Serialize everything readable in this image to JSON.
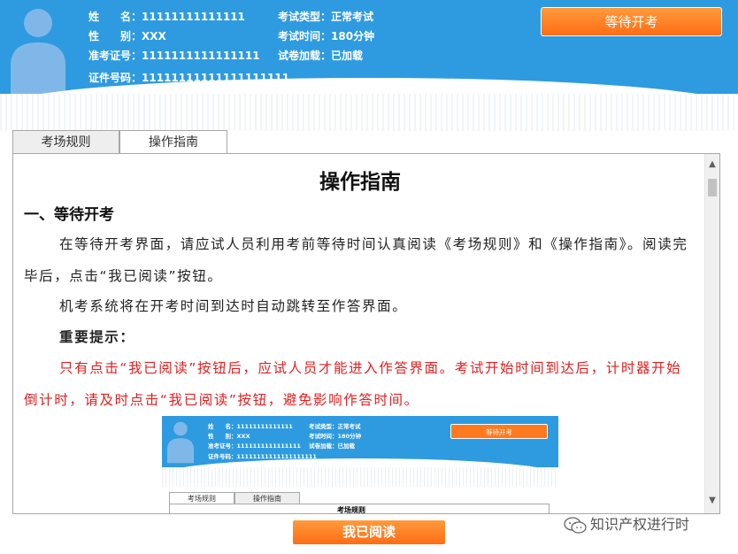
{
  "header": {
    "candidate": {
      "name_label": "姓　　名：",
      "name_value": "11111111111111",
      "gender_label": "性　　别：",
      "gender_value": "XXX",
      "admission_label": "准考证号：",
      "admission_value": "1111111111111111",
      "id_label": "证件号码：",
      "id_value": "11111111111111111111"
    },
    "exam": {
      "type_label": "考试类型：",
      "type_value": "正常考试",
      "time_label": "考试时间：",
      "time_value": "180分钟",
      "paper_label": "试卷加载：",
      "paper_value": "已加载"
    },
    "wait_button": "等待开考"
  },
  "tabs": [
    {
      "label": "考场规则",
      "active": false
    },
    {
      "label": "操作指南",
      "active": true
    }
  ],
  "content": {
    "title": "操作指南",
    "section_heading": "一、等待开考",
    "paragraph1": "在等待开考界面，请应试人员利用考前等待时间认真阅读《考场规则》和《操作指南》。阅读完毕后，点击“我已阅读”按钮。",
    "paragraph2": "机考系统将在开考时间到达时自动跳转至作答界面。",
    "important_heading": "重要提示：",
    "important_text": "只有点击“我已阅读”按钮后，应试人员才能进入作答界面。考试开始时间到达后，计时器开始倒计时，请及时点击“我已阅读”按钮，避免影响作答时间。"
  },
  "thumbnail": {
    "name": "姓　　名：11111111111111",
    "gender": "性　　别：XXX",
    "admission": "准考证号：1111111111111111",
    "id": "证件号码：11111111111111111111",
    "type": "考试类型：正常考试",
    "time": "考试时间：180分钟",
    "paper": "试卷加载：已加载",
    "button": "等待开考",
    "tab1": "考场规则",
    "tab2": "操作指南",
    "panel_title": "考场规则"
  },
  "read_button": "我已阅读",
  "watermark": "知识产权进行时",
  "colors": {
    "header_blue": "#2e9be0",
    "button_orange": "#ff7a1e",
    "alert_red": "#e02020"
  }
}
